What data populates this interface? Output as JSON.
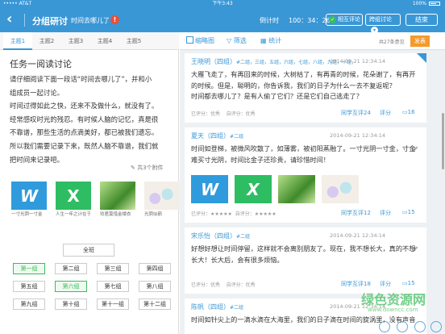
{
  "status_bar": {
    "carrier": "••••• AT&T",
    "time": "下午3:43",
    "battery": "100%"
  },
  "header": {
    "back_icon": "chevron-left-icon",
    "title": "分组研讨",
    "subtitle": "时间去哪儿了",
    "alert_icon": "!",
    "timer_label": "倒计时",
    "timer": "100：34：26",
    "mutual_review_label": "相互评论",
    "cross_discuss_label": "跨组讨论",
    "end_label": "结束"
  },
  "topics": [
    {
      "label": "主题1",
      "active": true
    },
    {
      "label": "主题2",
      "active": false
    },
    {
      "label": "主题3",
      "active": false
    },
    {
      "label": "主题4",
      "active": false
    },
    {
      "label": "主题5",
      "active": false
    }
  ],
  "task": {
    "title": "任务一阅读讨论",
    "lines": [
      "请仔细阅读下面一段话“时间去哪儿了”，并和小",
      "组成员一起讨论。",
      "时间过得如此之快，还来不及做什么，就没有了。",
      "经常感叹时光的残忍。有时候人脑的记忆，真是很",
      "不靠谱，那些生活的点滴美好，都已被我们遗忘。",
      "所以我们需要记录下来，既然人脑不靠谱，我们就",
      "把时间来记录吧。"
    ],
    "attachments_label": "共3个附件",
    "attachments": [
      {
        "type": "word",
        "glyph": "W",
        "caption": "一寸光阴一寸金"
      },
      {
        "type": "excel",
        "glyph": "X",
        "caption": "人生一年之计在于春"
      },
      {
        "type": "leaf",
        "glyph": "",
        "caption": "劝君莫惜金缕衣"
      },
      {
        "type": "eggs",
        "glyph": "",
        "caption": "光阴似箭"
      }
    ]
  },
  "groups": {
    "whole_class": "全班",
    "items": [
      "第一组",
      "第二组",
      "第三组",
      "第四组",
      "第五组",
      "第六组",
      "第七组",
      "第八组",
      "第九组",
      "第十组",
      "第十一组",
      "第十二组"
    ],
    "selected": [
      0,
      5
    ]
  },
  "toolbar": {
    "thumbnail_label": "缩略图",
    "filter_label": "筛选",
    "stats_label": "统计",
    "count_label": "共27条意见",
    "post_label": "发表"
  },
  "posts": [
    {
      "name": "王晓明（四组）",
      "group_tags": "#二组，三组，五组，六组，七组，八组，九组，十组，",
      "date": "2014-09-21  12:34:14",
      "text": "大雁飞走了，有再回来的时候，大树枯了，有再青的时候，花朵谢了，有再开的时候。但是，聪明的，你告诉我，我们的日子为什么一去不复返呢？",
      "text2": "时间都去哪儿了？是有人偷了它们？还是它们自己逃走了？",
      "other_rating_label": "已评分：优秀",
      "self_rating_label": "自评分：优秀",
      "mutual_label": "同学互评24",
      "score_label": "评分",
      "comments": "16"
    },
    {
      "name": "夏天（四组）",
      "group_tags": "#二组",
      "date": "2014-09-21  12:34:14",
      "text": "时间如登梯，被微风吹散了，如薄雾，被初阳蒸融了。一寸光阴一寸金，寸金难买寸光阴，时间比金子还珍贵，请珍惜时间！",
      "other_rating_label": "已评分：★★★★★",
      "self_rating_label": "自评分：★★★★★",
      "mutual_label": "同学互评12",
      "score_label": "评分",
      "comments": "15"
    },
    {
      "name": "宋乐怡（四组）",
      "group_tags": "#二组",
      "date": "2014-09-21  12:34:14",
      "text": "好想好想让时间停留，这样就不会离别朋友了。现在，我不想长大，真的不想长大！长大后，会有很多烦恼。",
      "other_rating_label": "已评分：优秀",
      "self_rating_label": "自评分：优秀",
      "mutual_label": "同学互评18",
      "score_label": "评分",
      "comments": "15"
    },
    {
      "name": "陈帆（四组）",
      "group_tags": "#二组",
      "date": "2014-09-21  12:34:14",
      "text": "时间如针尖上的一滴水滴在大海里，我们的日子滴在时间的旋涡里，没有声音"
    }
  ],
  "watermark": {
    "text": "绿色资源网",
    "url": "www.downcc.com"
  }
}
